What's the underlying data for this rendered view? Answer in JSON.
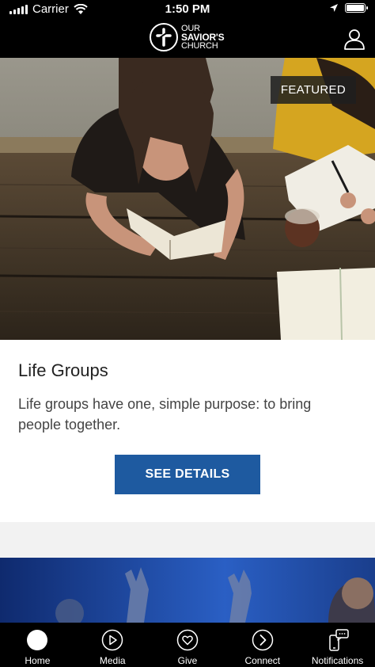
{
  "status_bar": {
    "carrier": "Carrier",
    "time": "1:50 PM"
  },
  "header": {
    "logo_line1": "OUR",
    "logo_line2": "SAVIOR'S",
    "logo_line3": "CHURCH"
  },
  "featured_card": {
    "badge": "FEATURED",
    "title": "Life Groups",
    "description": "Life groups have one, simple purpose: to bring people together.",
    "button_label": "SEE DETAILS"
  },
  "tabs": [
    {
      "label": "Home",
      "icon": "home-icon"
    },
    {
      "label": "Media",
      "icon": "play-icon"
    },
    {
      "label": "Give",
      "icon": "heart-icon"
    },
    {
      "label": "Connect",
      "icon": "arrow-right-icon"
    },
    {
      "label": "Notifications",
      "icon": "notifications-icon"
    }
  ],
  "colors": {
    "button": "#1e5aa0",
    "bars": "#000000",
    "second_card_blue": "#12327a"
  }
}
